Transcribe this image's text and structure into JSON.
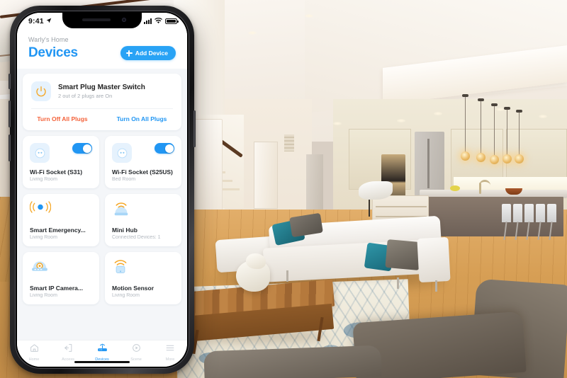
{
  "scene": {
    "description": "Open-plan modern living room with white sectional sofa, wood coffee table, blue patterned rug, kitchen island with stools and pendant lights"
  },
  "phone": {
    "status_bar": {
      "time": "9:41",
      "location_icon": "location-arrow-icon",
      "signal_icon": "cellular-signal-icon",
      "wifi_icon": "wifi-icon",
      "battery_icon": "battery-full-icon"
    },
    "header": {
      "home_name": "Warly's Home",
      "page_title": "Devices",
      "add_button_label": "Add Device",
      "add_button_icon": "plus-icon"
    },
    "master_card": {
      "icon": "power-icon",
      "title": "Smart Plug Master Switch",
      "subtitle": "2 out of 2 plugs are On",
      "turn_off_label": "Turn Off All Plugs",
      "turn_on_label": "Turn On All Plugs"
    },
    "devices": [
      {
        "name": "Wi-Fi Socket (S31)",
        "room": "Living Room",
        "icon": "socket-icon",
        "toggle": "on"
      },
      {
        "name": "Wi-Fi Socket (S25US)",
        "room": "Bed Room",
        "icon": "socket-icon",
        "toggle": "on"
      },
      {
        "name": "Smart Emergency...",
        "room": "Living Room",
        "icon": "emergency-sensor-icon",
        "toggle": "none"
      },
      {
        "name": "Mini Hub",
        "room": "Connected Devices: 1",
        "icon": "hub-icon",
        "toggle": "none"
      },
      {
        "name": "Smart IP Camera...",
        "room": "Living Room",
        "icon": "ip-camera-icon",
        "toggle": "none"
      },
      {
        "name": "Motion Sensor",
        "room": "Living Room",
        "icon": "motion-sensor-icon",
        "toggle": "none"
      }
    ],
    "tabs": [
      {
        "label": "Home",
        "icon": "home-icon",
        "active": false
      },
      {
        "label": "Access",
        "icon": "access-icon",
        "active": false
      },
      {
        "label": "Devices",
        "icon": "router-icon",
        "active": true
      },
      {
        "label": "Scene",
        "icon": "play-icon",
        "active": false
      },
      {
        "label": "More",
        "icon": "menu-icon",
        "active": false
      }
    ]
  },
  "colors": {
    "accent_blue": "#2196f3",
    "toggle_blue": "#2196f3",
    "warning_orange": "#f4623a",
    "icon_orange": "#f5a623",
    "icon_tile_bg": "#e6f2fd",
    "muted_text": "#b3b9c0",
    "page_bg": "#f4f6f9"
  }
}
